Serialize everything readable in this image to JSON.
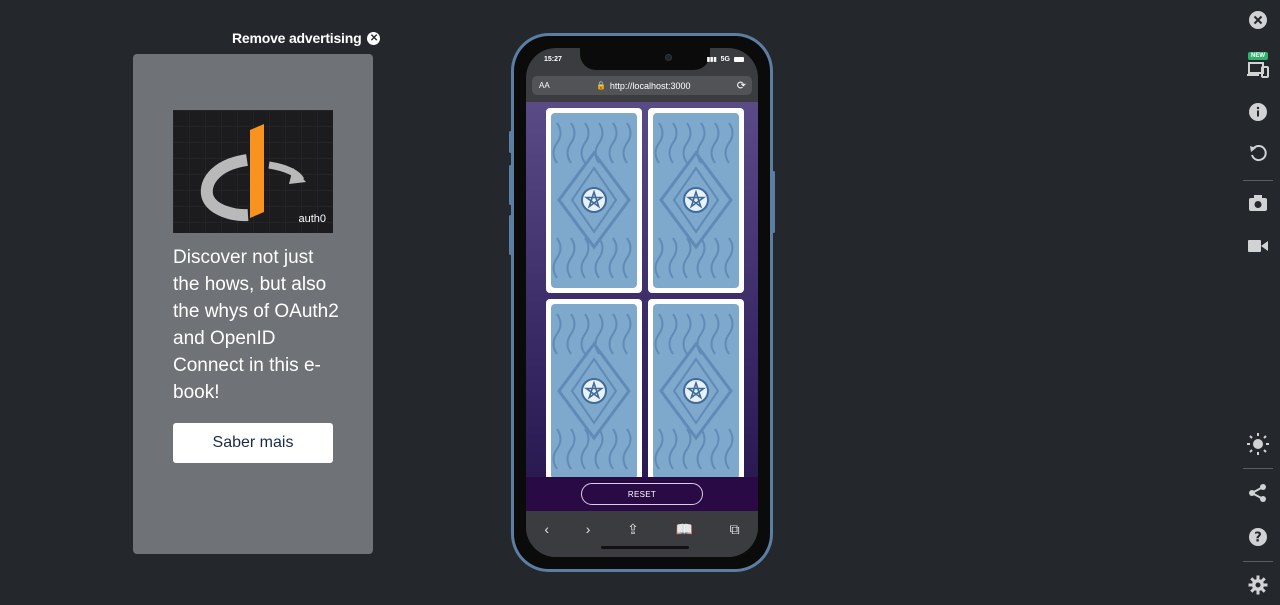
{
  "ad": {
    "remove_label": "Remove advertising",
    "logo_text": "auth0",
    "body": "Discover not just the hows, but also the whys of OAuth2 and OpenID Connect in this e-book!",
    "cta": "Saber mais"
  },
  "phone": {
    "time": "15:27",
    "network": "5G",
    "url_aa": "AA",
    "url": "http://localhost:3000",
    "reset_label": "RESET",
    "card_count": 4
  },
  "toolbar_icons": [
    "close-icon",
    "devices-icon",
    "info-icon",
    "rotate-icon",
    "camera-icon",
    "video-icon",
    "brightness-icon",
    "share-icon",
    "help-icon",
    "settings-icon"
  ],
  "badges": {
    "new": "NEW"
  },
  "colors": {
    "background": "#24282d",
    "ad_card": "#6f7276",
    "app_purple": "#2a0a45",
    "card_blue": "#7fa8cd"
  }
}
